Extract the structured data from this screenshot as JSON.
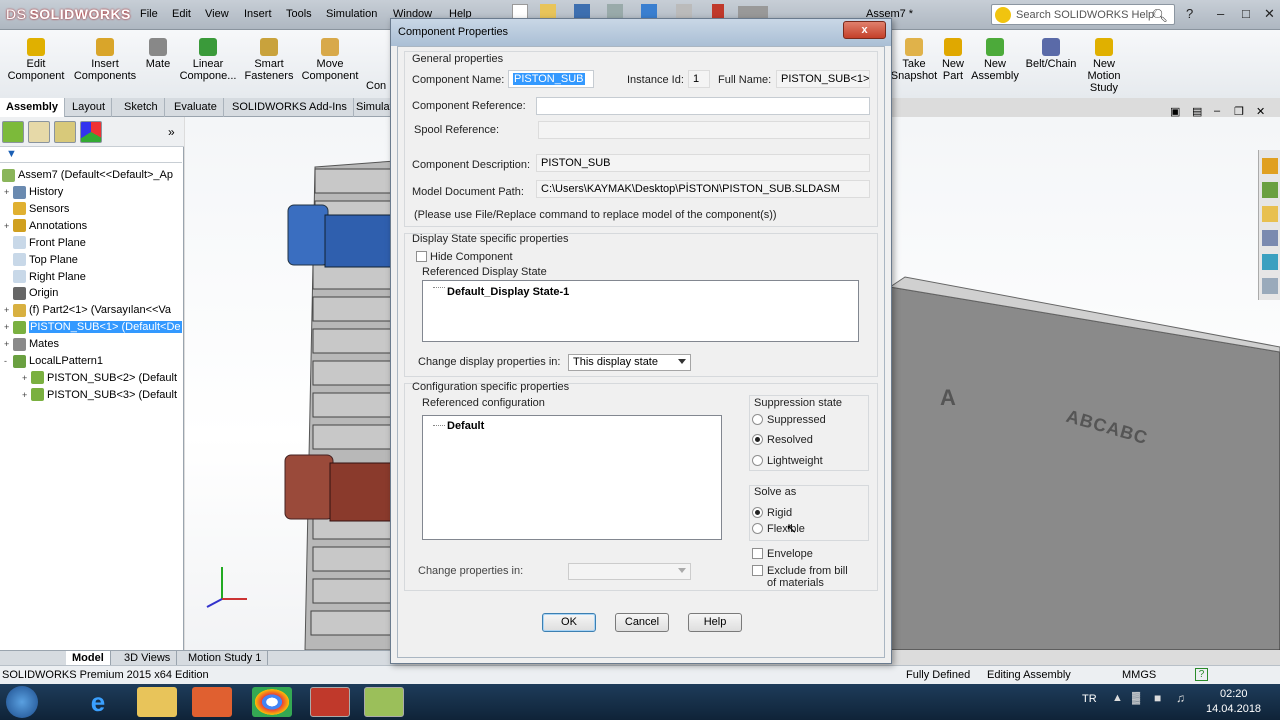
{
  "app": {
    "logo_prefix": "DS",
    "logo_text": "SOLIDWORKS",
    "document_title": "Assem7 *",
    "menu": [
      "File",
      "Edit",
      "View",
      "Insert",
      "Tools",
      "Simulation",
      "Window",
      "Help"
    ],
    "search_placeholder": "Search SOLIDWORKS Help"
  },
  "ribbon": {
    "left_buttons": [
      {
        "label": "Edit\nComponent",
        "icon": "edit-component-icon"
      },
      {
        "label": "Insert\nComponents",
        "icon": "insert-components-icon"
      },
      {
        "label": "Mate",
        "icon": "mate-icon"
      },
      {
        "label": "Linear\nCompone...",
        "icon": "linear-pattern-icon"
      },
      {
        "label": "Smart\nFasteners",
        "icon": "smart-fasteners-icon"
      },
      {
        "label": "Move\nComponent",
        "icon": "move-component-icon"
      }
    ],
    "partial_left_label": "Con",
    "right_buttons": [
      {
        "label": "Take\nSnapshot",
        "icon": "snapshot-icon"
      },
      {
        "label": "New\nPart",
        "icon": "new-part-icon"
      },
      {
        "label": "New\nAssembly",
        "icon": "new-assembly-icon"
      },
      {
        "label": "Belt/Chain",
        "icon": "belt-chain-icon"
      },
      {
        "label": "New\nMotion\nStudy",
        "icon": "motion-study-icon"
      }
    ]
  },
  "command_tabs": [
    "Assembly",
    "Layout",
    "Sketch",
    "Evaluate",
    "SOLIDWORKS Add-Ins",
    "Simulati"
  ],
  "feature_tree": {
    "root": "Assem7  (Default<<Default>_Ap",
    "items": [
      {
        "label": "History",
        "icon": "history-icon",
        "expand": "+"
      },
      {
        "label": "Sensors",
        "icon": "sensors-icon",
        "expand": ""
      },
      {
        "label": "Annotations",
        "icon": "annotations-icon",
        "expand": "+"
      },
      {
        "label": "Front Plane",
        "icon": "plane-icon",
        "expand": ""
      },
      {
        "label": "Top Plane",
        "icon": "plane-icon",
        "expand": ""
      },
      {
        "label": "Right Plane",
        "icon": "plane-icon",
        "expand": ""
      },
      {
        "label": "Origin",
        "icon": "origin-icon",
        "expand": ""
      },
      {
        "label": "(f) Part2<1> (Varsayılan<<Va",
        "icon": "part-icon",
        "expand": "+"
      },
      {
        "label": "PISTON_SUB<1> (Default<De",
        "icon": "subassembly-icon",
        "expand": "+",
        "selected": true
      },
      {
        "label": "Mates",
        "icon": "mates-icon",
        "expand": "+"
      },
      {
        "label": "LocalLPattern1",
        "icon": "pattern-icon",
        "expand": "-"
      },
      {
        "label": "PISTON_SUB<2> (Default",
        "icon": "subassembly-icon",
        "expand": "+",
        "indent": true
      },
      {
        "label": "PISTON_SUB<3> (Default",
        "icon": "subassembly-icon",
        "expand": "+",
        "indent": true
      }
    ]
  },
  "bottom_tabs": [
    "Model",
    "3D Views",
    "Motion Study 1"
  ],
  "status_bar": {
    "edition": "SOLIDWORKS Premium 2015 x64 Edition",
    "state": "Fully Defined",
    "mode": "Editing Assembly",
    "units": "MMGS"
  },
  "taskbar": {
    "lang": "TR",
    "time": "02:20",
    "date": "14.04.2018"
  },
  "dialog": {
    "title": "Component Properties",
    "close": "x",
    "general_label": "General properties",
    "component_name_label": "Component Name:",
    "component_name_value": "PISTON_SUB",
    "instance_id_label": "Instance Id:",
    "instance_id_value": "1",
    "full_name_label": "Full Name:",
    "full_name_value": "PISTON_SUB<1>",
    "component_reference_label": "Component Reference:",
    "component_reference_value": "",
    "spool_reference_label": "Spool Reference:",
    "spool_reference_value": "",
    "description_label": "Component Description:",
    "description_value": "PISTON_SUB",
    "model_path_label": "Model Document Path:",
    "model_path_value": "C:\\Users\\KAYMAK\\Desktop\\PİSTON\\PISTON_SUB.SLDASM",
    "replace_note": "(Please use File/Replace command to replace model of the component(s))",
    "display_state_group": "Display State specific properties",
    "hide_component_label": "Hide Component",
    "referenced_display_state_label": "Referenced Display State",
    "display_states": [
      "Default_Display State-1"
    ],
    "change_display_label": "Change display properties in:",
    "change_display_value": "This display state",
    "config_group": "Configuration specific properties",
    "referenced_config_label": "Referenced configuration",
    "configurations": [
      "Default"
    ],
    "suppression_label": "Suppression state",
    "suppression_options": [
      "Suppressed",
      "Resolved",
      "Lightweight"
    ],
    "suppression_selected": "Resolved",
    "solve_as_label": "Solve as",
    "solve_options": [
      "Rigid",
      "Flexible"
    ],
    "solve_selected": "Rigid",
    "envelope_label": "Envelope",
    "exclude_bom_label": "Exclude from bill\nof materials",
    "change_props_label": "Change properties in:",
    "change_props_value": "",
    "ok": "OK",
    "cancel": "Cancel",
    "help": "Help"
  },
  "viewport_labels": {
    "engraved_text_1": "A",
    "engraved_text_2": "ABCABC"
  }
}
